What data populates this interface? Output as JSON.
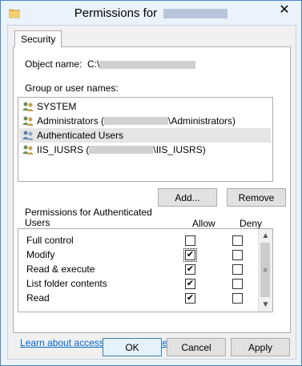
{
  "window": {
    "title": "Permissions for",
    "close_glyph": "✕"
  },
  "tab": {
    "label": "Security"
  },
  "object": {
    "label": "Object name:",
    "value_prefix": "C:\\"
  },
  "group": {
    "label": "Group or user names:",
    "users": [
      {
        "prefix": "SYSTEM",
        "suffix": ""
      },
      {
        "prefix": "Administrators (",
        "suffix": "\\Administrators)"
      },
      {
        "prefix": "Authenticated Users",
        "suffix": ""
      },
      {
        "prefix": "IIS_IUSRS (",
        "suffix": "\\IIS_IUSRS)"
      }
    ],
    "selected_index": 2
  },
  "buttons": {
    "add": "Add...",
    "remove": "Remove",
    "ok": "OK",
    "cancel": "Cancel",
    "apply": "Apply"
  },
  "permissions": {
    "title_line1": "Permissions for Authenticated",
    "title_line2": "Users",
    "allow_header": "Allow",
    "deny_header": "Deny",
    "rows": [
      {
        "name": "Full control",
        "allow": false,
        "deny": false
      },
      {
        "name": "Modify",
        "allow": true,
        "deny": false
      },
      {
        "name": "Read & execute",
        "allow": true,
        "deny": false
      },
      {
        "name": "List folder contents",
        "allow": true,
        "deny": false
      },
      {
        "name": "Read",
        "allow": true,
        "deny": false
      }
    ],
    "check_glyph": "✔"
  },
  "link": {
    "text": "Learn about access control and permissions"
  }
}
